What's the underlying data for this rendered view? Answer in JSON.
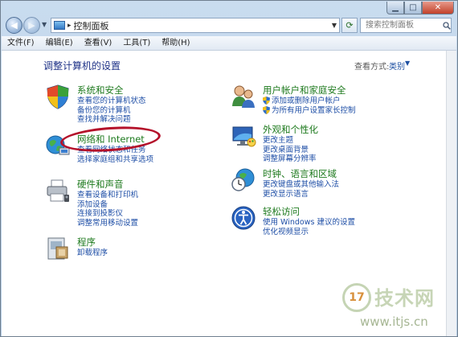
{
  "window": {
    "controls": {
      "minimize": "▁",
      "maximize": "□",
      "close": "✕"
    }
  },
  "address_bar": {
    "back": "◀",
    "forward": "▶",
    "separator": "▸",
    "path": "控制面板",
    "search_placeholder": "搜索控制面板"
  },
  "menu": [
    "文件(F)",
    "编辑(E)",
    "查看(V)",
    "工具(T)",
    "帮助(H)"
  ],
  "main": {
    "title": "调整计算机的设置",
    "view_by_label": "查看方式:",
    "view_by_value": "类别"
  },
  "categories": [
    {
      "id": "system",
      "title": "系统和安全",
      "links": [
        "查看您的计算机状态",
        "备份您的计算机",
        "查找并解决问题"
      ]
    },
    {
      "id": "network",
      "title": "网络和 Internet",
      "links": [
        "查看网络状态和任务",
        "选择家庭组和共享选项"
      ]
    },
    {
      "id": "hardware",
      "title": "硬件和声音",
      "links": [
        "查看设备和打印机",
        "添加设备",
        "连接到投影仪",
        "调整常用移动设置"
      ]
    },
    {
      "id": "programs",
      "title": "程序",
      "links": [
        "卸载程序"
      ]
    },
    {
      "id": "users",
      "title": "用户帐户和家庭安全",
      "links": [
        "添加或删除用户帐户",
        "为所有用户设置家长控制"
      ]
    },
    {
      "id": "appearance",
      "title": "外观和个性化",
      "links": [
        "更改主题",
        "更改桌面背景",
        "调整屏幕分辨率"
      ]
    },
    {
      "id": "clock",
      "title": "时钟、语言和区域",
      "links": [
        "更改键盘或其他输入法",
        "更改显示语言"
      ]
    },
    {
      "id": "access",
      "title": "轻松访问",
      "links": [
        "使用 Windows 建议的设置",
        "优化视频显示"
      ]
    }
  ],
  "watermark": {
    "logo": "17",
    "name": "技术网",
    "url": "www.itjs.cn"
  }
}
